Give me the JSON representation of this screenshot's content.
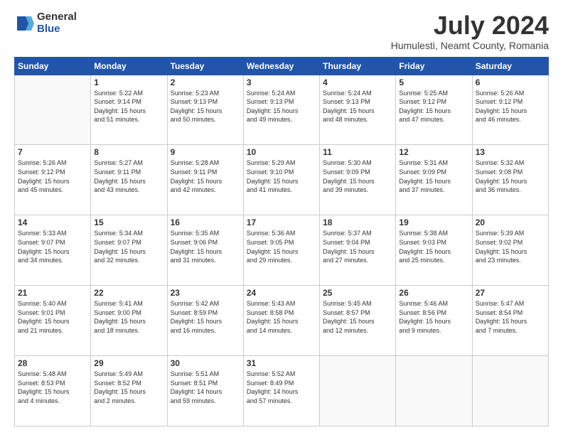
{
  "header": {
    "logo_general": "General",
    "logo_blue": "Blue",
    "month_title": "July 2024",
    "subtitle": "Humulesti, Neamt County, Romania"
  },
  "days_of_week": [
    "Sunday",
    "Monday",
    "Tuesday",
    "Wednesday",
    "Thursday",
    "Friday",
    "Saturday"
  ],
  "weeks": [
    [
      {
        "day": "",
        "info": ""
      },
      {
        "day": "1",
        "info": "Sunrise: 5:22 AM\nSunset: 9:14 PM\nDaylight: 15 hours\nand 51 minutes."
      },
      {
        "day": "2",
        "info": "Sunrise: 5:23 AM\nSunset: 9:13 PM\nDaylight: 15 hours\nand 50 minutes."
      },
      {
        "day": "3",
        "info": "Sunrise: 5:24 AM\nSunset: 9:13 PM\nDaylight: 15 hours\nand 49 minutes."
      },
      {
        "day": "4",
        "info": "Sunrise: 5:24 AM\nSunset: 9:13 PM\nDaylight: 15 hours\nand 48 minutes."
      },
      {
        "day": "5",
        "info": "Sunrise: 5:25 AM\nSunset: 9:12 PM\nDaylight: 15 hours\nand 47 minutes."
      },
      {
        "day": "6",
        "info": "Sunrise: 5:26 AM\nSunset: 9:12 PM\nDaylight: 15 hours\nand 46 minutes."
      }
    ],
    [
      {
        "day": "7",
        "info": "Sunrise: 5:26 AM\nSunset: 9:12 PM\nDaylight: 15 hours\nand 45 minutes."
      },
      {
        "day": "8",
        "info": "Sunrise: 5:27 AM\nSunset: 9:11 PM\nDaylight: 15 hours\nand 43 minutes."
      },
      {
        "day": "9",
        "info": "Sunrise: 5:28 AM\nSunset: 9:11 PM\nDaylight: 15 hours\nand 42 minutes."
      },
      {
        "day": "10",
        "info": "Sunrise: 5:29 AM\nSunset: 9:10 PM\nDaylight: 15 hours\nand 41 minutes."
      },
      {
        "day": "11",
        "info": "Sunrise: 5:30 AM\nSunset: 9:09 PM\nDaylight: 15 hours\nand 39 minutes."
      },
      {
        "day": "12",
        "info": "Sunrise: 5:31 AM\nSunset: 9:09 PM\nDaylight: 15 hours\nand 37 minutes."
      },
      {
        "day": "13",
        "info": "Sunrise: 5:32 AM\nSunset: 9:08 PM\nDaylight: 15 hours\nand 36 minutes."
      }
    ],
    [
      {
        "day": "14",
        "info": "Sunrise: 5:33 AM\nSunset: 9:07 PM\nDaylight: 15 hours\nand 34 minutes."
      },
      {
        "day": "15",
        "info": "Sunrise: 5:34 AM\nSunset: 9:07 PM\nDaylight: 15 hours\nand 32 minutes."
      },
      {
        "day": "16",
        "info": "Sunrise: 5:35 AM\nSunset: 9:06 PM\nDaylight: 15 hours\nand 31 minutes."
      },
      {
        "day": "17",
        "info": "Sunrise: 5:36 AM\nSunset: 9:05 PM\nDaylight: 15 hours\nand 29 minutes."
      },
      {
        "day": "18",
        "info": "Sunrise: 5:37 AM\nSunset: 9:04 PM\nDaylight: 15 hours\nand 27 minutes."
      },
      {
        "day": "19",
        "info": "Sunrise: 5:38 AM\nSunset: 9:03 PM\nDaylight: 15 hours\nand 25 minutes."
      },
      {
        "day": "20",
        "info": "Sunrise: 5:39 AM\nSunset: 9:02 PM\nDaylight: 15 hours\nand 23 minutes."
      }
    ],
    [
      {
        "day": "21",
        "info": "Sunrise: 5:40 AM\nSunset: 9:01 PM\nDaylight: 15 hours\nand 21 minutes."
      },
      {
        "day": "22",
        "info": "Sunrise: 5:41 AM\nSunset: 9:00 PM\nDaylight: 15 hours\nand 18 minutes."
      },
      {
        "day": "23",
        "info": "Sunrise: 5:42 AM\nSunset: 8:59 PM\nDaylight: 15 hours\nand 16 minutes."
      },
      {
        "day": "24",
        "info": "Sunrise: 5:43 AM\nSunset: 8:58 PM\nDaylight: 15 hours\nand 14 minutes."
      },
      {
        "day": "25",
        "info": "Sunrise: 5:45 AM\nSunset: 8:57 PM\nDaylight: 15 hours\nand 12 minutes."
      },
      {
        "day": "26",
        "info": "Sunrise: 5:46 AM\nSunset: 8:56 PM\nDaylight: 15 hours\nand 9 minutes."
      },
      {
        "day": "27",
        "info": "Sunrise: 5:47 AM\nSunset: 8:54 PM\nDaylight: 15 hours\nand 7 minutes."
      }
    ],
    [
      {
        "day": "28",
        "info": "Sunrise: 5:48 AM\nSunset: 8:53 PM\nDaylight: 15 hours\nand 4 minutes."
      },
      {
        "day": "29",
        "info": "Sunrise: 5:49 AM\nSunset: 8:52 PM\nDaylight: 15 hours\nand 2 minutes."
      },
      {
        "day": "30",
        "info": "Sunrise: 5:51 AM\nSunset: 8:51 PM\nDaylight: 14 hours\nand 59 minutes."
      },
      {
        "day": "31",
        "info": "Sunrise: 5:52 AM\nSunset: 8:49 PM\nDaylight: 14 hours\nand 57 minutes."
      },
      {
        "day": "",
        "info": ""
      },
      {
        "day": "",
        "info": ""
      },
      {
        "day": "",
        "info": ""
      }
    ]
  ]
}
